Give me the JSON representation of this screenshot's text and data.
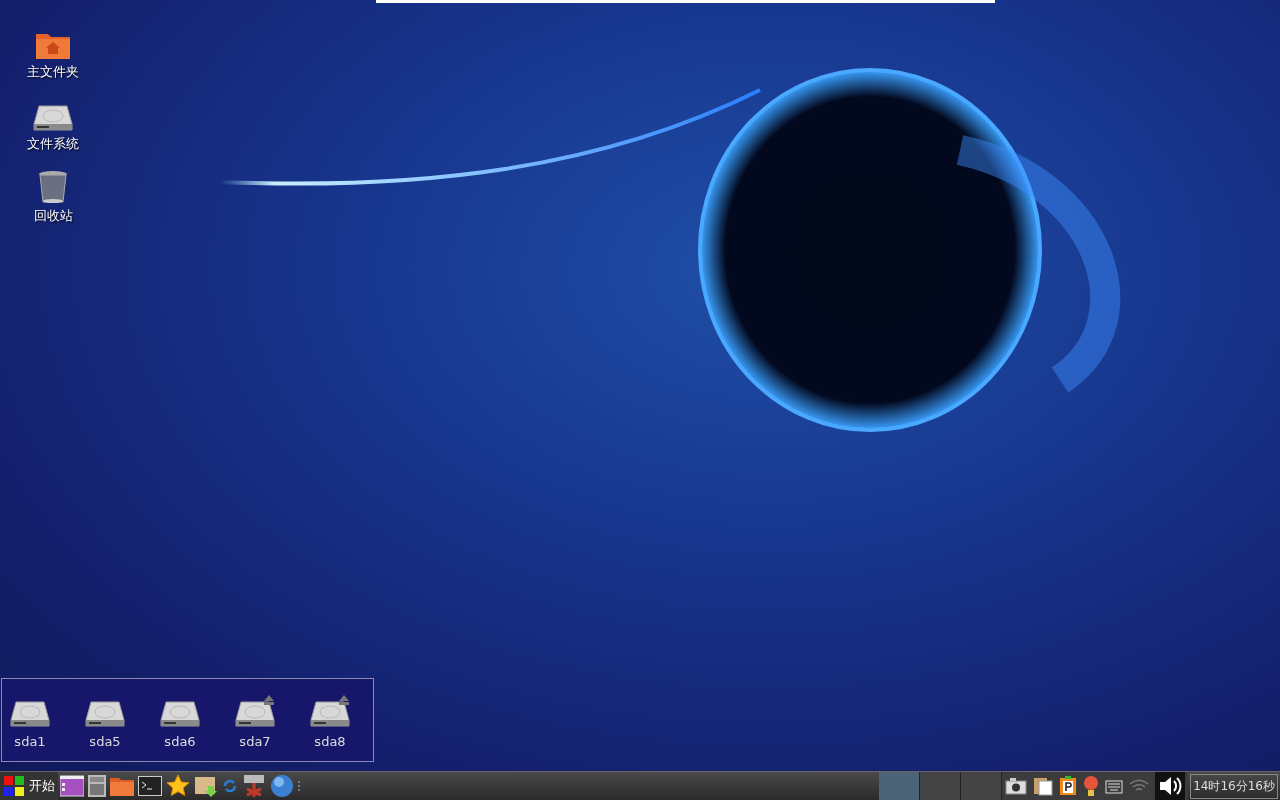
{
  "desktop_icons": [
    {
      "label": "主文件夹",
      "kind": "home"
    },
    {
      "label": "文件系统",
      "kind": "drive"
    },
    {
      "label": "回收站",
      "kind": "trash"
    }
  ],
  "drives": [
    {
      "label": "sda1",
      "ejectable": false
    },
    {
      "label": "sda5",
      "ejectable": false
    },
    {
      "label": "sda6",
      "ejectable": false
    },
    {
      "label": "sda7",
      "ejectable": true
    },
    {
      "label": "sda8",
      "ejectable": true
    }
  ],
  "taskbar": {
    "start_label": "开始",
    "launchers": [
      {
        "kind": "window"
      },
      {
        "kind": "calculator"
      },
      {
        "kind": "folder"
      },
      {
        "kind": "terminal"
      },
      {
        "kind": "star"
      },
      {
        "kind": "package"
      },
      {
        "kind": "refresh"
      },
      {
        "kind": "tool"
      },
      {
        "kind": "globe"
      }
    ],
    "workspaces": [
      {
        "selected": true
      },
      {
        "selected": false
      },
      {
        "selected": false
      }
    ],
    "tray": [
      {
        "kind": "camera"
      },
      {
        "kind": "clipboard"
      },
      {
        "kind": "parking"
      },
      {
        "kind": "bulb"
      },
      {
        "kind": "keyboard"
      },
      {
        "kind": "wifi"
      },
      {
        "kind": "volume"
      }
    ],
    "clock": "14时16分16秒"
  }
}
